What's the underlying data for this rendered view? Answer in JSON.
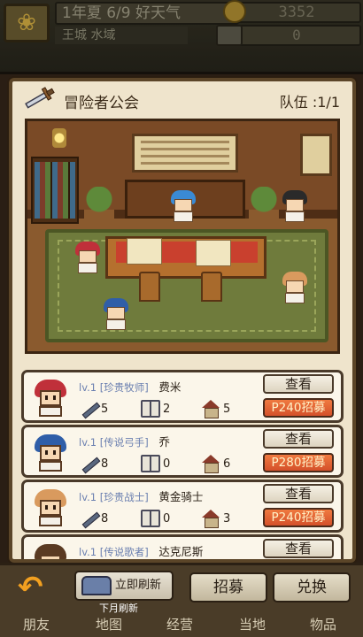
{
  "topbar": {
    "date": "1年夏 6/9 好天气",
    "gold": "3352",
    "location": "王城 水域",
    "resource": "0"
  },
  "panel": {
    "title": "冒险者公会",
    "team": "队伍 :1/1"
  },
  "adventurers": [
    {
      "level": "lv.1",
      "class": "[珍贵牧师]",
      "name": "费米",
      "attack": "5",
      "book": "2",
      "house": "5",
      "view_label": "查看",
      "recruit_label": "P240招募",
      "hair_color": "#c0303a"
    },
    {
      "level": "lv.1",
      "class": "[传说弓手]",
      "name": "乔",
      "attack": "8",
      "book": "0",
      "house": "6",
      "view_label": "查看",
      "recruit_label": "P280招募",
      "hair_color": "#2f5ea8"
    },
    {
      "level": "lv.1",
      "class": "[珍贵战士]",
      "name": "黄金骑士",
      "attack": "8",
      "book": "0",
      "house": "3",
      "view_label": "查看",
      "recruit_label": "P240招募",
      "hair_color": "#d99a5e"
    },
    {
      "level": "lv.1",
      "class": "[传说歌者]",
      "name": "达克尼斯",
      "attack": "",
      "book": "",
      "house": "",
      "view_label": "查看",
      "recruit_label": "",
      "hair_color": "#5a3a22"
    }
  ],
  "bottom": {
    "refresh_label": "立即刷新",
    "refresh_sub": "下月刷新",
    "recruit_button": "招募",
    "exchange_button": "兑换",
    "nav": [
      "朋友",
      "地图",
      "经营",
      "当地",
      "物品"
    ]
  },
  "colors": {
    "recruit": "#d4502a",
    "panel_bg": "#efe4cc",
    "class_text": "#6a7fb0"
  }
}
